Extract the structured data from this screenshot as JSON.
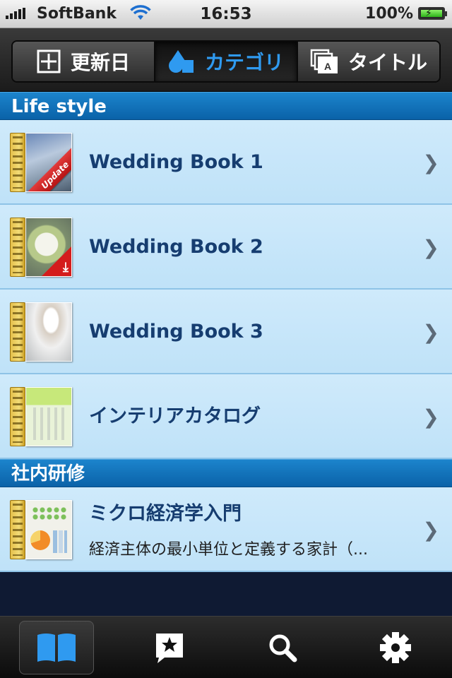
{
  "status_bar": {
    "carrier": "SoftBank",
    "time": "16:53",
    "battery_percent": "100%",
    "signal_icon": "signal-bars-icon",
    "wifi_icon": "wifi-icon",
    "battery_icon": "battery-charging-icon"
  },
  "segmented_control": {
    "segments": [
      {
        "label": "更新日",
        "icon": "calendar-icon",
        "selected": false
      },
      {
        "label": "カテゴリ",
        "icon": "shapes-icon",
        "selected": true
      },
      {
        "label": "タイトル",
        "icon": "stacked-pages-icon",
        "selected": false
      }
    ]
  },
  "sections": [
    {
      "header": "Life style",
      "items": [
        {
          "title": "Wedding Book 1",
          "badge": "Update"
        },
        {
          "title": "Wedding Book 2",
          "badge_icon": "download-icon"
        },
        {
          "title": "Wedding Book 3"
        },
        {
          "title": "インテリアカタログ"
        }
      ]
    },
    {
      "header": "社内研修",
      "items": [
        {
          "title": "ミクロ経済学入門",
          "subtitle": "経済主体の最小単位と定義する家計（..."
        }
      ]
    }
  ],
  "tab_bar": {
    "tabs": [
      {
        "icon": "book-icon",
        "selected": true
      },
      {
        "icon": "bookmark-star-icon",
        "selected": false
      },
      {
        "icon": "search-icon",
        "selected": false
      },
      {
        "icon": "gear-icon",
        "selected": false
      }
    ]
  },
  "colors": {
    "accent": "#2f9af0",
    "section_header": "#0a62a8",
    "row_background": "#c6e6fa",
    "row_title": "#163d70"
  }
}
